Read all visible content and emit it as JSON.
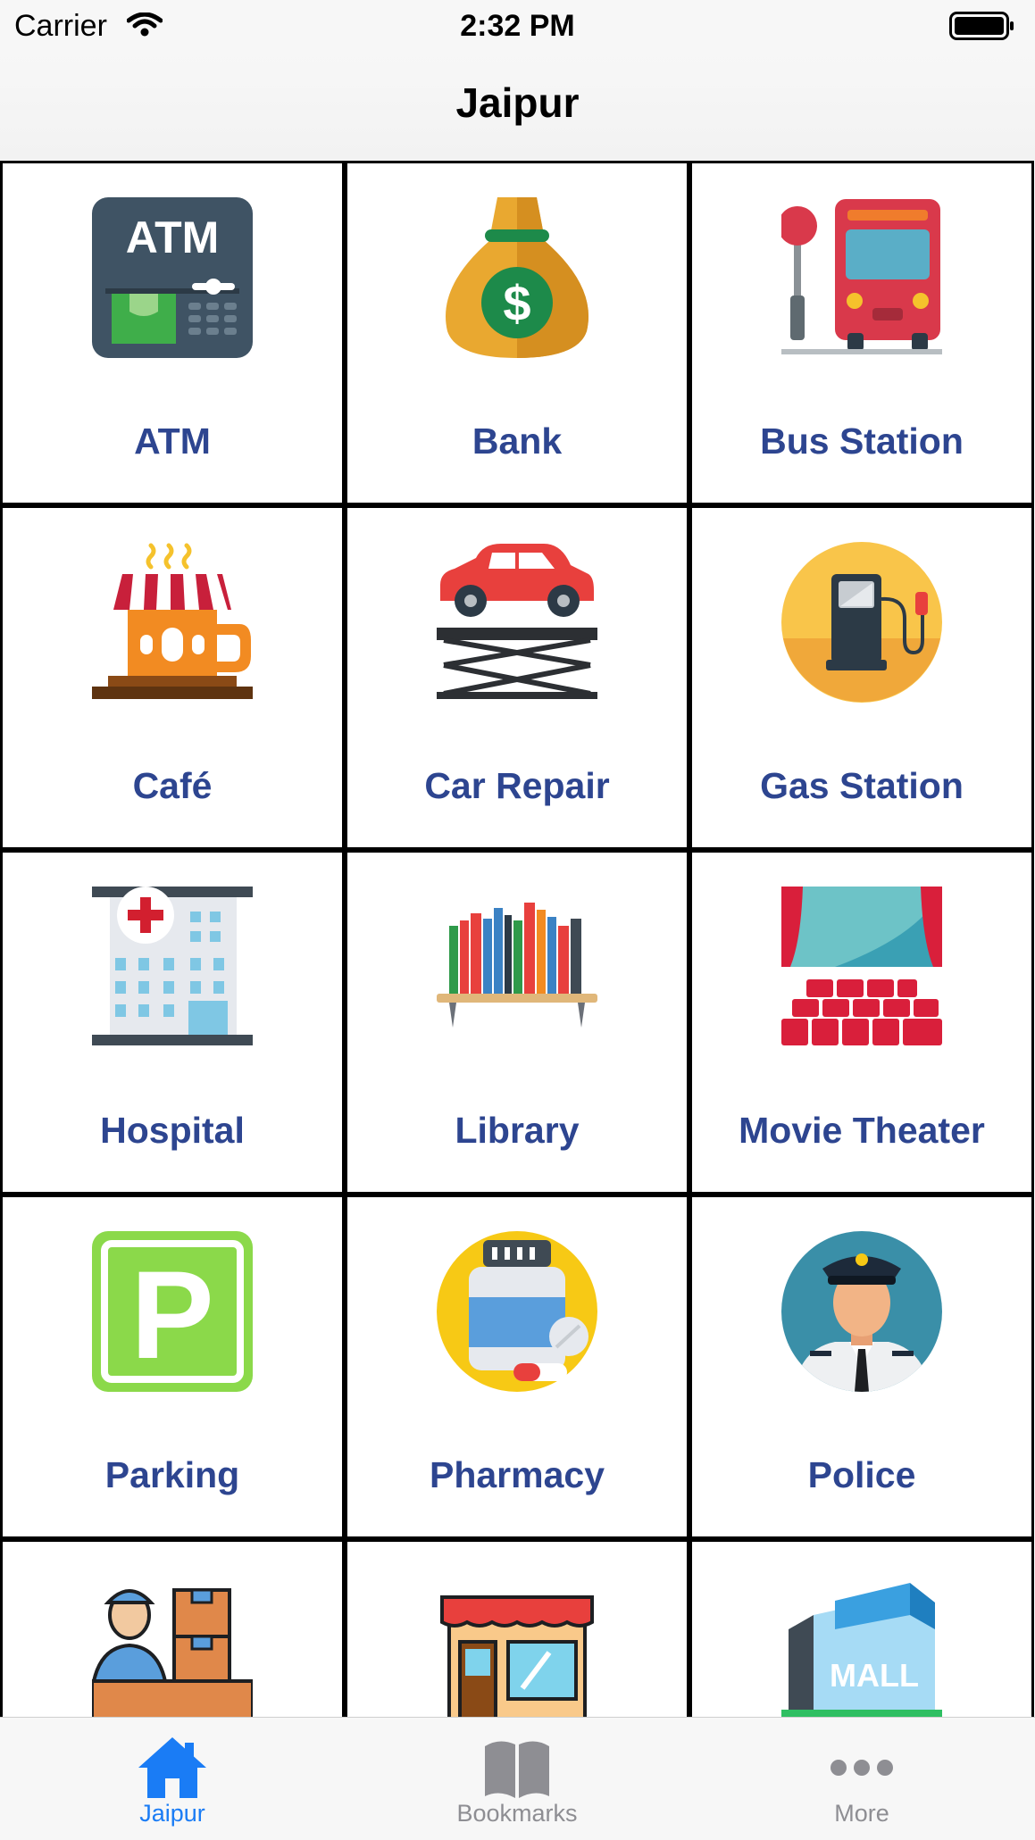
{
  "status_bar": {
    "carrier": "Carrier",
    "time": "2:32 PM"
  },
  "nav": {
    "title": "Jaipur"
  },
  "grid": {
    "items": [
      {
        "label": "ATM",
        "icon": "atm-icon"
      },
      {
        "label": "Bank",
        "icon": "money-bag-icon"
      },
      {
        "label": "Bus Station",
        "icon": "bus-stop-icon"
      },
      {
        "label": "Café",
        "icon": "cafe-icon"
      },
      {
        "label": "Car Repair",
        "icon": "car-lift-icon"
      },
      {
        "label": "Gas Station",
        "icon": "fuel-pump-icon"
      },
      {
        "label": "Hospital",
        "icon": "hospital-icon"
      },
      {
        "label": "Library",
        "icon": "bookshelf-icon"
      },
      {
        "label": "Movie Theater",
        "icon": "theater-icon"
      },
      {
        "label": "Parking",
        "icon": "parking-icon"
      },
      {
        "label": "Pharmacy",
        "icon": "medicine-bottle-icon"
      },
      {
        "label": "Police",
        "icon": "police-officer-icon"
      },
      {
        "label": "",
        "icon": "courier-icon"
      },
      {
        "label": "",
        "icon": "store-icon"
      },
      {
        "label": "",
        "icon": "mall-icon"
      }
    ]
  },
  "tab_bar": {
    "tabs": [
      {
        "label": "Jaipur",
        "icon": "home-icon",
        "selected": true
      },
      {
        "label": "Bookmarks",
        "icon": "book-icon",
        "selected": false
      },
      {
        "label": "More",
        "icon": "more-icon",
        "selected": false
      }
    ]
  },
  "colors": {
    "label": "#2d4590",
    "tab_active": "#1a7cf5",
    "tab_inactive": "#8e8e93"
  }
}
